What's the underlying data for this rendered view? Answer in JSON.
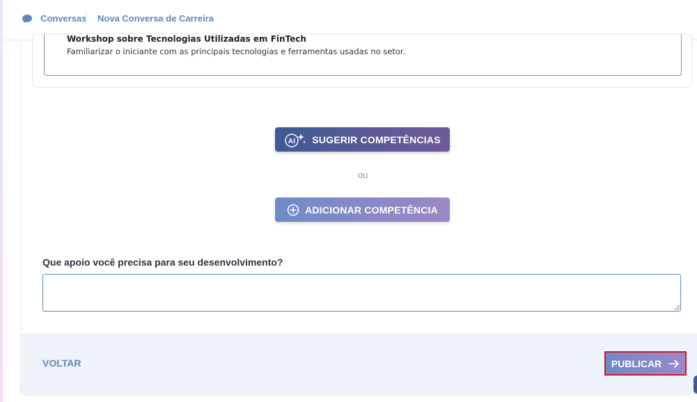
{
  "breadcrumb": {
    "items": [
      "Conversas",
      "Nova Conversa de Carreira"
    ]
  },
  "plan": {
    "title": "Workshop sobre Tecnologias Utilizadas em FinTech",
    "description": "Familiarizar o iniciante com as principais tecnologias e ferramentas usadas no setor."
  },
  "actions": {
    "suggest_label": "SUGERIR COMPETÊNCIAS",
    "ai_badge": "AI",
    "or_text": "ou",
    "add_label": "ADICIONAR COMPETÊNCIA"
  },
  "support": {
    "question": "Que apoio você precisa para seu desenvolvimento?",
    "value": ""
  },
  "footer": {
    "back_label": "VOLTAR",
    "publish_label": "PUBLICAR"
  },
  "colors": {
    "accent_blue": "#5f86bd",
    "suggest_gradient_start": "#3e5a94",
    "suggest_gradient_end": "#6f5a98",
    "highlight_border": "#d11a2a"
  },
  "icons": {
    "breadcrumb": "chat-bubble-icon",
    "suggest": "ai-sparkle-icon",
    "add": "plus-circle-icon",
    "publish": "arrow-right-icon"
  }
}
